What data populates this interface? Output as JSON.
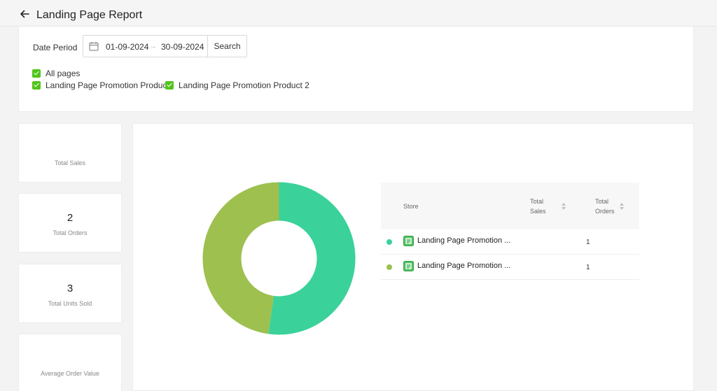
{
  "header": {
    "title": "Landing Page Report",
    "back_icon": "arrow-left-icon"
  },
  "filter": {
    "date_label": "Date Period",
    "date_start": "01-09-2024",
    "date_arrow": "→",
    "date_end": "30-09-2024",
    "search_label": "Search",
    "checkboxes": [
      {
        "label": "All pages",
        "checked": true
      },
      {
        "label": "Landing Page Promotion Product",
        "checked": true
      },
      {
        "label": "Landing Page Promotion Product 2",
        "checked": true
      }
    ]
  },
  "stats": [
    {
      "value": "",
      "label": "Total Sales"
    },
    {
      "value": "2",
      "label": "Total Orders"
    },
    {
      "value": "3",
      "label": "Total Units Sold"
    },
    {
      "value": "",
      "label": "Average Order Value"
    }
  ],
  "colors": {
    "accent": "#52c41a",
    "series1": "#3ad29a",
    "series2": "#9dc04f"
  },
  "chart_data": {
    "type": "pie",
    "categories": [
      "Landing Page Promotion Product",
      "Landing Page Promotion Product 2"
    ],
    "values": [
      1,
      1
    ],
    "slice_colors": [
      "#3ad29a",
      "#9dc04f"
    ]
  },
  "table": {
    "headers": {
      "store": "Store",
      "total_sales": [
        "Total",
        "Sales"
      ],
      "total_orders": [
        "Total",
        "Orders"
      ]
    },
    "rows": [
      {
        "store": "Landing Page Promotion ...",
        "total_sales": "",
        "total_orders": "1",
        "color": "#3ad29a"
      },
      {
        "store": "Landing Page Promotion ...",
        "total_sales": "",
        "total_orders": "1",
        "color": "#9dc04f"
      }
    ]
  }
}
